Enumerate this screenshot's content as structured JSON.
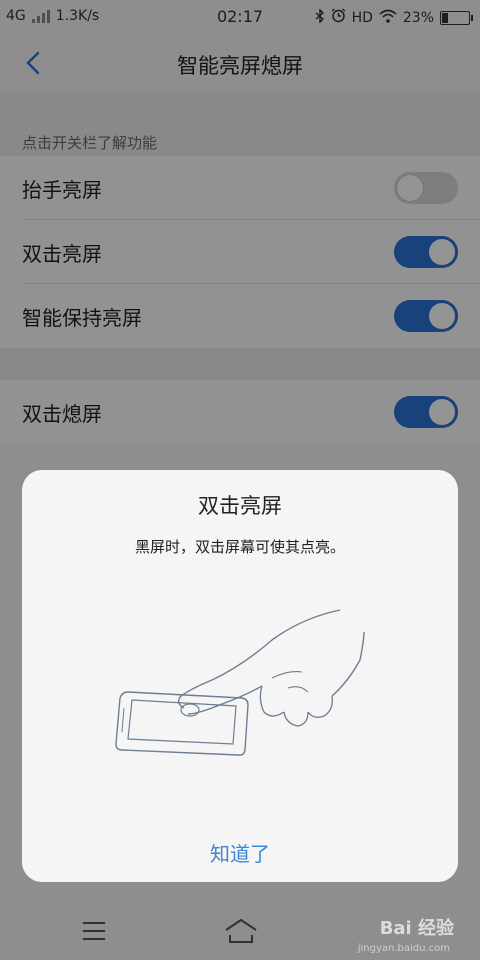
{
  "status_bar": {
    "network": "4G",
    "speed": "1.3K/s",
    "time": "02:17",
    "hd": "HD",
    "battery": "23%",
    "battery_level": 0.23
  },
  "header": {
    "title": "智能亮屏熄屏"
  },
  "hint": "点击开关栏了解功能",
  "settings": [
    {
      "label": "抬手亮屏",
      "on": false
    },
    {
      "label": "双击亮屏",
      "on": true
    },
    {
      "label": "智能保持亮屏",
      "on": true
    },
    {
      "label": "双击熄屏",
      "on": true
    }
  ],
  "dialog": {
    "title": "双击亮屏",
    "description": "黑屏时，双击屏幕可使其点亮。",
    "confirm": "知道了"
  },
  "watermark": {
    "brand": "Bai 经验",
    "url": "jingyan.baidu.com"
  },
  "colors": {
    "accent": "#2b73d6",
    "link": "#3c86d6",
    "toggle_off": "#d7d7d7"
  }
}
